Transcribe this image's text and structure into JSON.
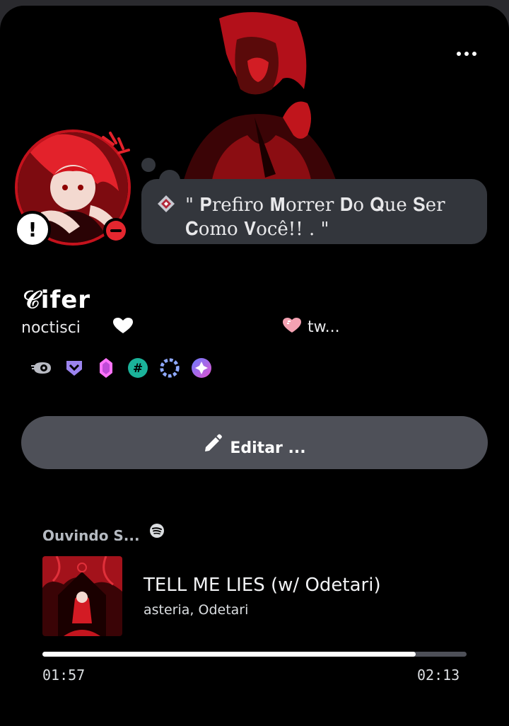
{
  "status": {
    "emoji": "sparkle-gem-icon",
    "text": "\" 𝐏refiro 𝐌orrer 𝐃o 𝐐ue 𝐒er 𝐂omo 𝐕ocê!! . \""
  },
  "profile": {
    "display_name": "𝒞ifer",
    "username": "noctisci",
    "pronouns": "tw..."
  },
  "badges": [
    "nitro-badge",
    "hypesquad-bravery-badge",
    "boost-gem-badge",
    "hashtag-badge",
    "quest-laurel-badge",
    "orbs-badge"
  ],
  "edit_button": {
    "label": "Editar ..."
  },
  "activity": {
    "header": "Ouvindo S...",
    "track_title": "TELL ME LIES (w/ Odetari)",
    "artists": "asteria,  Odetari",
    "elapsed": "01:57",
    "duration": "02:13",
    "progress": 0.88
  },
  "colors": {
    "background": "#000000",
    "bubble": "#33363c",
    "button": "#4e5058",
    "dnd": "#e4272f",
    "spotify": "#1db954"
  }
}
